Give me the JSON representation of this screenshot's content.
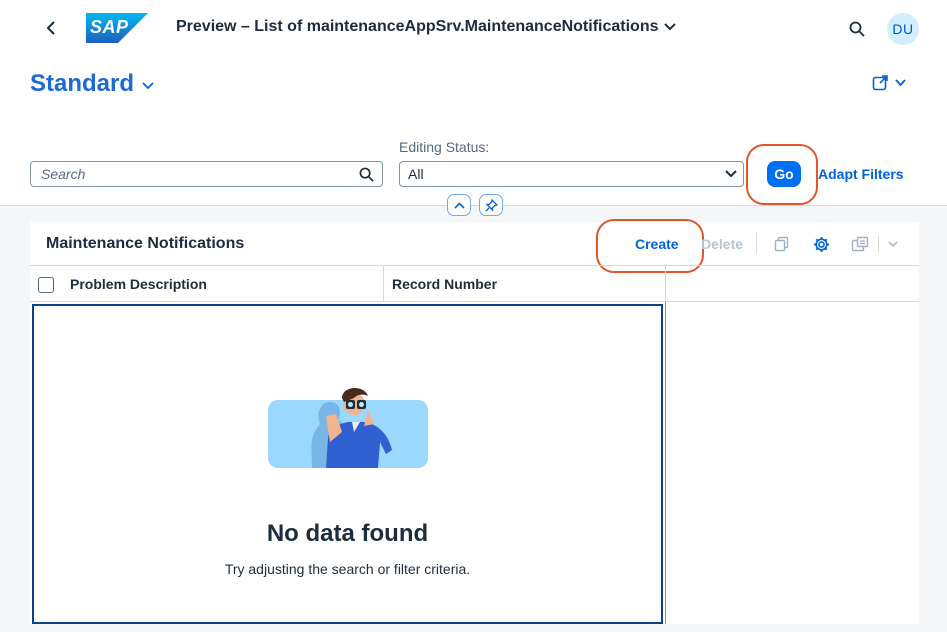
{
  "shell": {
    "logo_text": "SAP",
    "app_title": "Preview – List of maintenanceAppSrv.MaintenanceNotifications",
    "user_initials": "DU"
  },
  "header": {
    "variant_title": "Standard"
  },
  "filters": {
    "search_placeholder": "Search",
    "editing_status_label": "Editing Status:",
    "editing_status_value": "All",
    "go_label": "Go",
    "adapt_filters_label": "Adapt Filters"
  },
  "table": {
    "title": "Maintenance Notifications",
    "create_label": "Create",
    "delete_label": "Delete",
    "columns": [
      "Problem Description",
      "Record Number"
    ],
    "rows": [],
    "no_data_title": "No data found",
    "no_data_subtitle": "Try adjusting the search or filter criteria."
  },
  "colors": {
    "accent": "#0070f2",
    "highlight_ring": "#e0562c"
  },
  "icons": [
    "back-icon",
    "search-icon",
    "chevron-down-icon",
    "share-icon",
    "collapse-up-icon",
    "pin-icon",
    "copy-icon",
    "settings-icon",
    "export-icon"
  ]
}
